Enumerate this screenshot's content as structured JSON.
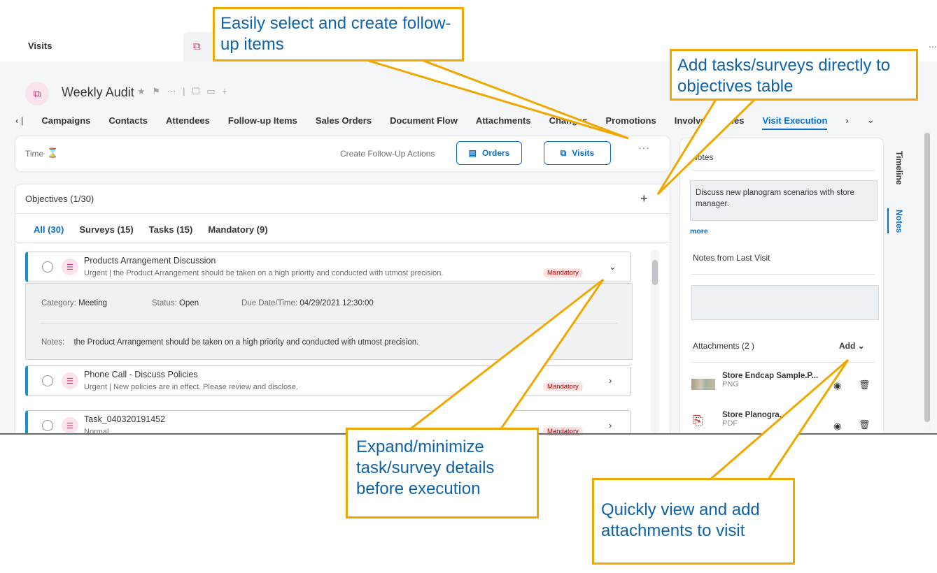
{
  "top": {
    "visits_tab": "Visits",
    "more": "..."
  },
  "header": {
    "title": "Weekly Audit",
    "extras": "★ ⚑ ⋯ | ☐ ▭ +"
  },
  "nav": {
    "prev": "‹ |",
    "items": [
      "Campaigns",
      "Contacts",
      "Attendees",
      "Follow-up Items",
      "Sales Orders",
      "Document Flow",
      "Attachments",
      "Changes",
      "Promotions",
      "Involved Parties",
      "Visit Execution"
    ],
    "active": "Visit Execution",
    "next": "›",
    "overflow": "⌄"
  },
  "time_card": {
    "time_label": "Time",
    "hourglass": "⌛",
    "actions_label": "Create Follow-Up Actions",
    "orders_button": "Orders",
    "visits_button": "Visits",
    "more": "···"
  },
  "objectives": {
    "title": "Objectives (1/30)",
    "add": "+",
    "tabs": [
      "All (30)",
      "Surveys (15)",
      "Tasks (15)",
      "Mandatory (9)"
    ],
    "items": [
      {
        "name": "Products Arrangement Discussion",
        "desc": "Urgent | the Product Arrangement should be taken on a high priority and conducted with utmost precision.",
        "badge": "Mandatory",
        "chevron": "⌄",
        "details": {
          "category_key": "Category:",
          "category_val": "Meeting",
          "status_key": "Status:",
          "status_val": "Open",
          "due_key": "Due Date/Time:",
          "due_val": "04/29/2021 12:30:00",
          "notes_key": "Notes:",
          "notes_val": "the Product Arrangement should be taken on a high priority and conducted with utmost precision."
        }
      },
      {
        "name": "Phone Call - Discuss Policies",
        "desc": "Urgent | New policies are in effect. Please review and disclose.",
        "badge": "Mandatory",
        "chevron": "›"
      },
      {
        "name": "Task_040320191452",
        "desc": "Normal",
        "badge": "Mandatory",
        "chevron": "›"
      }
    ]
  },
  "side": {
    "notes_heading": "Notes",
    "note_text": "Discuss new planogram scenarios with store manager.",
    "more": "more",
    "last_visit_label": "Notes from Last Visit",
    "attachments_label": "Attachments (2 )",
    "add_label": "Add ⌄",
    "attachments": [
      {
        "name": "Store Endcap Sample.P...",
        "type": "PNG"
      },
      {
        "name": "Store Planogra...",
        "type": "PDF"
      }
    ],
    "vtab_timeline": "Timeline",
    "vtab_notes": "Notes"
  },
  "callouts": {
    "select_followup": "Easily select and create follow-up items",
    "add_tasks": "Add tasks/surveys directly to objectives table",
    "expand": "Expand/minimize task/survey details before execution",
    "attachments": "Quickly view and add attachments to visit"
  },
  "colors": {
    "accent": "#0a6ed1",
    "callout_border": "#f0a800",
    "callout_text": "#0f62a8",
    "mandatory_bg": "#ffe1e1",
    "objective_bar": "#1b90c9"
  }
}
